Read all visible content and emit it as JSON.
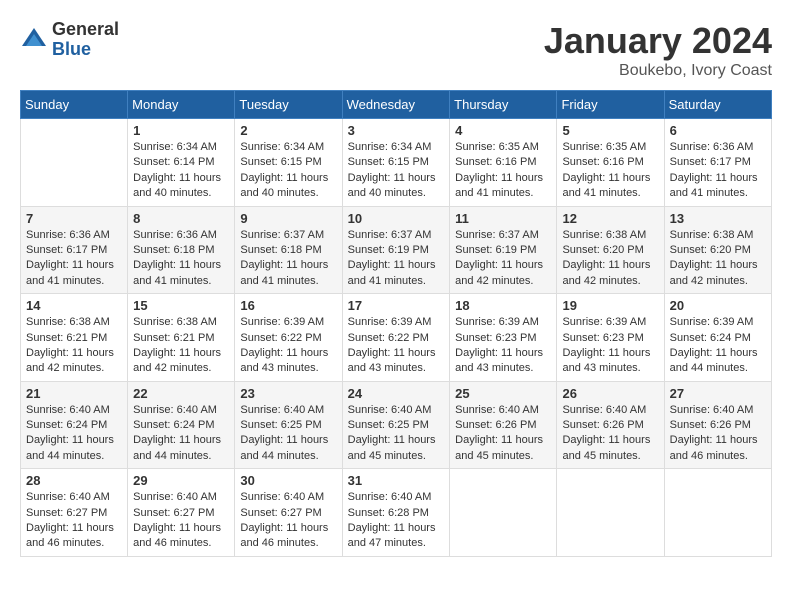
{
  "logo": {
    "general": "General",
    "blue": "Blue"
  },
  "title": "January 2024",
  "subtitle": "Boukebo, Ivory Coast",
  "weekdays": [
    "Sunday",
    "Monday",
    "Tuesday",
    "Wednesday",
    "Thursday",
    "Friday",
    "Saturday"
  ],
  "weeks": [
    [
      {
        "day": "",
        "sunrise": "",
        "sunset": "",
        "daylight": ""
      },
      {
        "day": "1",
        "sunrise": "Sunrise: 6:34 AM",
        "sunset": "Sunset: 6:14 PM",
        "daylight": "Daylight: 11 hours and 40 minutes."
      },
      {
        "day": "2",
        "sunrise": "Sunrise: 6:34 AM",
        "sunset": "Sunset: 6:15 PM",
        "daylight": "Daylight: 11 hours and 40 minutes."
      },
      {
        "day": "3",
        "sunrise": "Sunrise: 6:34 AM",
        "sunset": "Sunset: 6:15 PM",
        "daylight": "Daylight: 11 hours and 40 minutes."
      },
      {
        "day": "4",
        "sunrise": "Sunrise: 6:35 AM",
        "sunset": "Sunset: 6:16 PM",
        "daylight": "Daylight: 11 hours and 41 minutes."
      },
      {
        "day": "5",
        "sunrise": "Sunrise: 6:35 AM",
        "sunset": "Sunset: 6:16 PM",
        "daylight": "Daylight: 11 hours and 41 minutes."
      },
      {
        "day": "6",
        "sunrise": "Sunrise: 6:36 AM",
        "sunset": "Sunset: 6:17 PM",
        "daylight": "Daylight: 11 hours and 41 minutes."
      }
    ],
    [
      {
        "day": "7",
        "sunrise": "Sunrise: 6:36 AM",
        "sunset": "Sunset: 6:17 PM",
        "daylight": "Daylight: 11 hours and 41 minutes."
      },
      {
        "day": "8",
        "sunrise": "Sunrise: 6:36 AM",
        "sunset": "Sunset: 6:18 PM",
        "daylight": "Daylight: 11 hours and 41 minutes."
      },
      {
        "day": "9",
        "sunrise": "Sunrise: 6:37 AM",
        "sunset": "Sunset: 6:18 PM",
        "daylight": "Daylight: 11 hours and 41 minutes."
      },
      {
        "day": "10",
        "sunrise": "Sunrise: 6:37 AM",
        "sunset": "Sunset: 6:19 PM",
        "daylight": "Daylight: 11 hours and 41 minutes."
      },
      {
        "day": "11",
        "sunrise": "Sunrise: 6:37 AM",
        "sunset": "Sunset: 6:19 PM",
        "daylight": "Daylight: 11 hours and 42 minutes."
      },
      {
        "day": "12",
        "sunrise": "Sunrise: 6:38 AM",
        "sunset": "Sunset: 6:20 PM",
        "daylight": "Daylight: 11 hours and 42 minutes."
      },
      {
        "day": "13",
        "sunrise": "Sunrise: 6:38 AM",
        "sunset": "Sunset: 6:20 PM",
        "daylight": "Daylight: 11 hours and 42 minutes."
      }
    ],
    [
      {
        "day": "14",
        "sunrise": "Sunrise: 6:38 AM",
        "sunset": "Sunset: 6:21 PM",
        "daylight": "Daylight: 11 hours and 42 minutes."
      },
      {
        "day": "15",
        "sunrise": "Sunrise: 6:38 AM",
        "sunset": "Sunset: 6:21 PM",
        "daylight": "Daylight: 11 hours and 42 minutes."
      },
      {
        "day": "16",
        "sunrise": "Sunrise: 6:39 AM",
        "sunset": "Sunset: 6:22 PM",
        "daylight": "Daylight: 11 hours and 43 minutes."
      },
      {
        "day": "17",
        "sunrise": "Sunrise: 6:39 AM",
        "sunset": "Sunset: 6:22 PM",
        "daylight": "Daylight: 11 hours and 43 minutes."
      },
      {
        "day": "18",
        "sunrise": "Sunrise: 6:39 AM",
        "sunset": "Sunset: 6:23 PM",
        "daylight": "Daylight: 11 hours and 43 minutes."
      },
      {
        "day": "19",
        "sunrise": "Sunrise: 6:39 AM",
        "sunset": "Sunset: 6:23 PM",
        "daylight": "Daylight: 11 hours and 43 minutes."
      },
      {
        "day": "20",
        "sunrise": "Sunrise: 6:39 AM",
        "sunset": "Sunset: 6:24 PM",
        "daylight": "Daylight: 11 hours and 44 minutes."
      }
    ],
    [
      {
        "day": "21",
        "sunrise": "Sunrise: 6:40 AM",
        "sunset": "Sunset: 6:24 PM",
        "daylight": "Daylight: 11 hours and 44 minutes."
      },
      {
        "day": "22",
        "sunrise": "Sunrise: 6:40 AM",
        "sunset": "Sunset: 6:24 PM",
        "daylight": "Daylight: 11 hours and 44 minutes."
      },
      {
        "day": "23",
        "sunrise": "Sunrise: 6:40 AM",
        "sunset": "Sunset: 6:25 PM",
        "daylight": "Daylight: 11 hours and 44 minutes."
      },
      {
        "day": "24",
        "sunrise": "Sunrise: 6:40 AM",
        "sunset": "Sunset: 6:25 PM",
        "daylight": "Daylight: 11 hours and 45 minutes."
      },
      {
        "day": "25",
        "sunrise": "Sunrise: 6:40 AM",
        "sunset": "Sunset: 6:26 PM",
        "daylight": "Daylight: 11 hours and 45 minutes."
      },
      {
        "day": "26",
        "sunrise": "Sunrise: 6:40 AM",
        "sunset": "Sunset: 6:26 PM",
        "daylight": "Daylight: 11 hours and 45 minutes."
      },
      {
        "day": "27",
        "sunrise": "Sunrise: 6:40 AM",
        "sunset": "Sunset: 6:26 PM",
        "daylight": "Daylight: 11 hours and 46 minutes."
      }
    ],
    [
      {
        "day": "28",
        "sunrise": "Sunrise: 6:40 AM",
        "sunset": "Sunset: 6:27 PM",
        "daylight": "Daylight: 11 hours and 46 minutes."
      },
      {
        "day": "29",
        "sunrise": "Sunrise: 6:40 AM",
        "sunset": "Sunset: 6:27 PM",
        "daylight": "Daylight: 11 hours and 46 minutes."
      },
      {
        "day": "30",
        "sunrise": "Sunrise: 6:40 AM",
        "sunset": "Sunset: 6:27 PM",
        "daylight": "Daylight: 11 hours and 46 minutes."
      },
      {
        "day": "31",
        "sunrise": "Sunrise: 6:40 AM",
        "sunset": "Sunset: 6:28 PM",
        "daylight": "Daylight: 11 hours and 47 minutes."
      },
      {
        "day": "",
        "sunrise": "",
        "sunset": "",
        "daylight": ""
      },
      {
        "day": "",
        "sunrise": "",
        "sunset": "",
        "daylight": ""
      },
      {
        "day": "",
        "sunrise": "",
        "sunset": "",
        "daylight": ""
      }
    ]
  ]
}
